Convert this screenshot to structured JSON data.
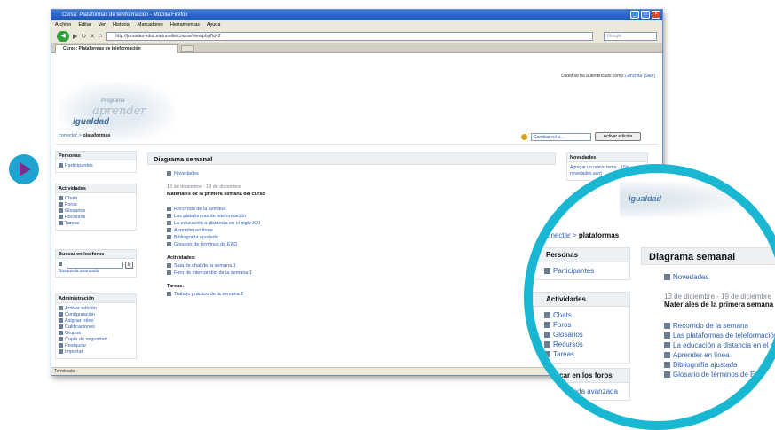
{
  "browser": {
    "title": "Curso: Plataformas de teleformación - Mozilla Firefox",
    "menu": [
      "Archivo",
      "Editar",
      "Ver",
      "Historial",
      "Marcadores",
      "Herramientas",
      "Ayuda"
    ],
    "url": "http://jornadas-educ.es/moodle/course/view.php?id=2",
    "search_placeholder": "Google",
    "tab_title": "Curso: Plataformas de teleformación",
    "status": "Terminado"
  },
  "page": {
    "logged_in_prefix": "Usted se ha autentificado como",
    "logged_in_user": "Conchita (Salir)",
    "logo": {
      "line1": "Programa",
      "line2": "aprender",
      "line3": "igualdad"
    },
    "breadcrumb": {
      "link": "conectar",
      "current": "plataformas"
    },
    "role_select": "Cambiar rol a...",
    "edit_button": "Activar edición",
    "course_title": "Diagrama semanal",
    "news": "Novedades",
    "week_date": "13 de diciembre - 19 de diciembre",
    "week_title": "Materiales de la primera semana del curso",
    "resources": [
      "Recorrido de la semana",
      "Las plataformas de teleformación",
      "La educación a distancia en el siglo XXI",
      "Aprender en línea",
      "Bibliografía ajustada",
      "Glosario de términos de EAD"
    ],
    "activities_title": "Actividades:",
    "activities_list": [
      "Sala de chat de la semana 1",
      "Foro de intercambio de la semana 1"
    ],
    "tasks_title": "Tareas:",
    "tasks_list": [
      "Trabajo práctico de la semana 1"
    ]
  },
  "sidebar": {
    "people": {
      "title": "Personas",
      "items": [
        "Participantes"
      ]
    },
    "activities": {
      "title": "Actividades",
      "items": [
        "Chats",
        "Foros",
        "Glosarios",
        "Recursos",
        "Tareas"
      ]
    },
    "search": {
      "title": "Buscar en los foros",
      "go": "Ir",
      "advanced": "Búsqueda avanzada"
    },
    "admin": {
      "title": "Administración",
      "items": [
        "Activar edición",
        "Configuración",
        "Asignar roles",
        "Calificaciones",
        "Grupos",
        "Copia de seguridad",
        "Restaurar",
        "Importar"
      ]
    }
  },
  "right": {
    "title": "Novedades",
    "text": "Agregar un nuevo tema... (Sin novedades aún)"
  },
  "colors": {
    "accent_ring": "#1ab7d2",
    "bullet": "#1fa3d0",
    "bullet_arrow": "#7a2f8f",
    "link": "#3060b0"
  }
}
